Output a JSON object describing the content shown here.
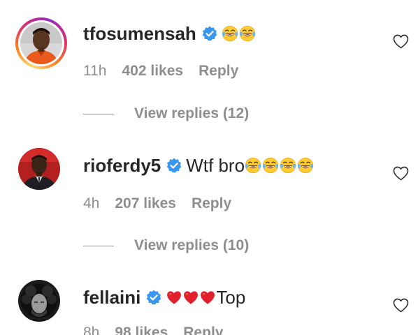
{
  "comments": [
    {
      "username": "tfosumensah",
      "text": "",
      "emojis": [
        "face-with-tears-of-joy",
        "face-with-tears-of-joy"
      ],
      "time": "11h",
      "likes": "402 likes",
      "reply": "Reply",
      "view_replies": "View replies (12)",
      "avatar_ring": true
    },
    {
      "username": "rioferdy5",
      "text": "Wtf bro",
      "emojis": [
        "face-with-tears-of-joy",
        "face-with-tears-of-joy",
        "face-with-tears-of-joy",
        "face-with-tears-of-joy"
      ],
      "time": "4h",
      "likes": "207 likes",
      "reply": "Reply",
      "view_replies": "View replies (10)",
      "avatar_ring": false
    },
    {
      "username": "fellaini",
      "text": "Top",
      "emojis": [
        "red-heart",
        "red-heart",
        "red-heart"
      ],
      "time": "8h",
      "likes": "98 likes",
      "reply": "Reply",
      "avatar_ring": false
    }
  ],
  "colors": {
    "text": "#262626",
    "meta": "#8e8e8e",
    "verified": "#3897f0",
    "heart": "#e0212b",
    "emoji": "#ffcc33"
  },
  "icons": {
    "verified": "verified-badge-icon",
    "like": "heart-outline-icon"
  }
}
